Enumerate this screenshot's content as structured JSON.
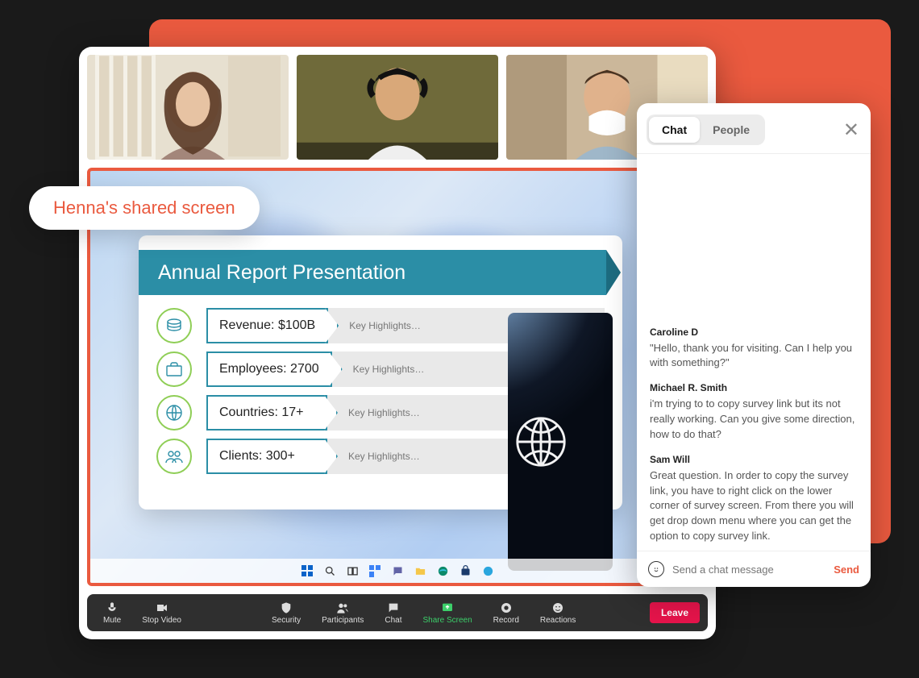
{
  "colors": {
    "accent": "#ea5a3f",
    "teal": "#2b8ea6",
    "green_border": "#8fce56"
  },
  "float_label": "Henna's shared screen",
  "slide": {
    "title": "Annual Report Presentation",
    "highlight_placeholder": "Key Highlights…",
    "rows": [
      {
        "label": "Revenue: $100B",
        "icon": "coins-icon"
      },
      {
        "label": "Employees: 2700",
        "icon": "briefcase-icon"
      },
      {
        "label": "Countries: 17+",
        "icon": "globe-icon"
      },
      {
        "label": "Clients: 300+",
        "icon": "people-icon"
      }
    ]
  },
  "controls": {
    "mute": "Mute",
    "stop_video": "Stop Video",
    "security": "Security",
    "participants": "Participants",
    "chat": "Chat",
    "share_screen": "Share Screen",
    "record": "Record",
    "reactions": "Reactions",
    "leave": "Leave"
  },
  "chat": {
    "tab_chat": "Chat",
    "tab_people": "People",
    "placeholder": "Send a chat message",
    "send": "Send",
    "messages": [
      {
        "sender": "Caroline D",
        "text": "\"Hello, thank you for visiting. Can I help you with something?\""
      },
      {
        "sender": "Michael R. Smith",
        "text": "i'm trying to to copy survey link but its not really working. Can you give some direction, how to do that?"
      },
      {
        "sender": "Sam Will",
        "text": "Great question. In order to copy the survey link, you have to right click on the lower corner of survey screen. From there you will get drop down menu where you can get the option to copy survey link."
      }
    ]
  }
}
